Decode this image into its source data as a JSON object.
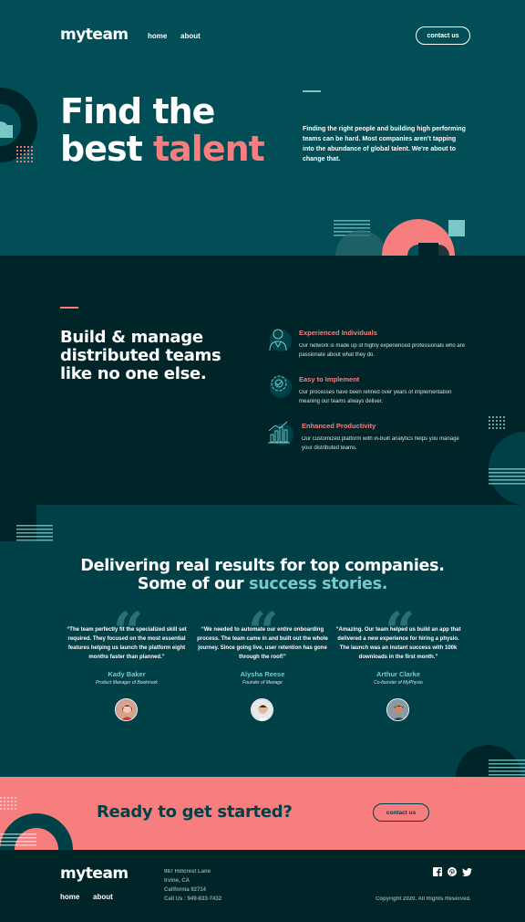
{
  "header": {
    "logo": "myteam",
    "nav": [
      "home",
      "about"
    ],
    "contact_label": "contact us"
  },
  "hero": {
    "title_line1": "Find the",
    "title_line2_plain": "best",
    "title_line2_accent": "talent",
    "description": "Finding the right people and building high performing teams can be hard. Most companies aren't tapping into the abundance of global talent. We're about to change that."
  },
  "features": {
    "title": "Build & manage distributed teams like no one else.",
    "items": [
      {
        "title": "Experienced Individuals",
        "text": "Our network is made up of highly experienced professionals who are passionate about what they do.",
        "icon": "person-icon"
      },
      {
        "title": "Easy to Implement",
        "text": "Our processes have been refined over years of implementation meaning our teams always deliver.",
        "icon": "cog-icon"
      },
      {
        "title": "Enhanced Productivity",
        "text": "Our customized platform with in-built analytics helps you manage your distributed teams.",
        "icon": "chart-icon"
      }
    ]
  },
  "testimonials": {
    "title_plain": "Delivering real results for top companies. Some of our",
    "title_accent": "success stories.",
    "items": [
      {
        "quote": "“The team perfectly fit the specialized skill set required. They focused on the most essential features helping us launch the platform eight months faster than planned.”",
        "name": "Kady Baker",
        "role": "Product Manager of Bookmark"
      },
      {
        "quote": "“We needed to automate our entire onboarding process. The team came in and built out the whole journey. Since going live, user retention has gone through the roof!”",
        "name": "Alysha Reese",
        "role": "Founder of Manage"
      },
      {
        "quote": "“Amazing. Our team helped us build an app that delivered a new experience for hiring a physio. The launch was an instant success with 100k downloads in the first month.”",
        "name": "Arthur Clarke",
        "role": "Co-founder of MyPhysio"
      }
    ]
  },
  "cta": {
    "title": "Ready to get started?",
    "button": "contact us"
  },
  "footer": {
    "logo": "myteam",
    "nav": [
      "home",
      "about"
    ],
    "address": [
      "987 Hillcrest Lane",
      "Irvine, CA",
      "California 92714",
      "Call Us : 949-833-7432"
    ],
    "copyright": "Copyright 2020. All Rights Reserved.",
    "social": [
      "facebook-icon",
      "pinterest-icon",
      "twitter-icon"
    ]
  },
  "colors": {
    "coral": "#f67e7e",
    "mint": "#79c8c7",
    "dark_teal": "#002529",
    "teal": "#004047",
    "hero_teal": "#014e56"
  }
}
